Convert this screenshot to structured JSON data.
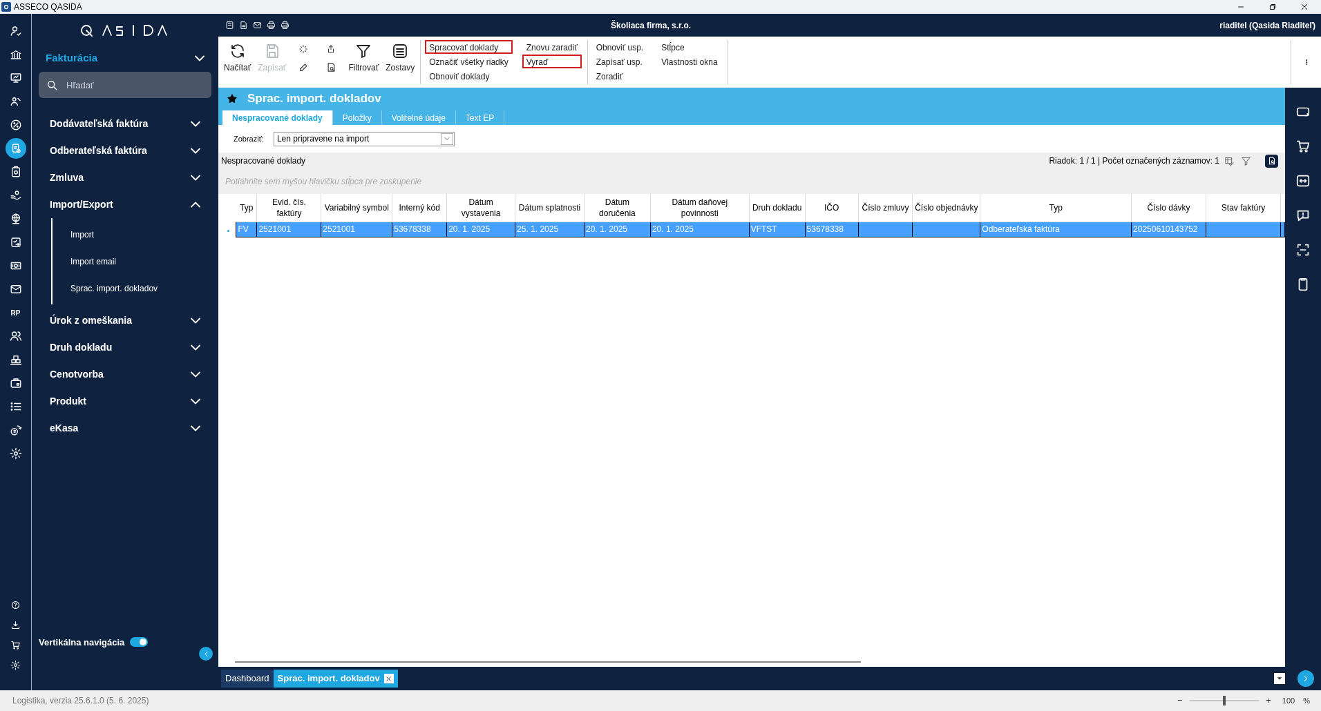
{
  "app_title": "ASSECO QASIDA",
  "header": {
    "company": "Školiaca firma, s.r.o.",
    "user": "riaditel (Qasida Riaditeľ)"
  },
  "rail": [
    {
      "kind": "icon",
      "selected": false
    },
    {
      "kind": "icon",
      "selected": false
    },
    {
      "kind": "icon",
      "selected": false
    },
    {
      "kind": "icon",
      "selected": false
    },
    {
      "kind": "icon",
      "selected": false
    },
    {
      "kind": "icon",
      "selected": true
    },
    {
      "kind": "icon",
      "selected": false
    },
    {
      "kind": "icon",
      "selected": false
    },
    {
      "kind": "icon",
      "selected": false
    },
    {
      "kind": "icon",
      "selected": false
    },
    {
      "kind": "icon",
      "selected": false
    },
    {
      "kind": "icon",
      "selected": false
    },
    {
      "kind": "text",
      "label": "RP",
      "selected": false
    },
    {
      "kind": "icon",
      "selected": false
    },
    {
      "kind": "icon",
      "selected": false
    },
    {
      "kind": "icon",
      "selected": false
    },
    {
      "kind": "icon",
      "selected": false
    },
    {
      "kind": "icon",
      "selected": false
    },
    {
      "kind": "icon",
      "selected": false
    }
  ],
  "sidebar": {
    "module": "Fakturácia",
    "search": {
      "placeholder": "Hľadať"
    },
    "items": [
      {
        "label": "Dodávateľská faktúra",
        "expanded": false
      },
      {
        "label": "Odberateľská faktúra",
        "expanded": false
      },
      {
        "label": "Zmluva",
        "expanded": false
      },
      {
        "label": "Import/Export",
        "expanded": true,
        "children": [
          {
            "label": "Import"
          },
          {
            "label": "Import email"
          },
          {
            "label": "Sprac. import. dokladov"
          }
        ]
      },
      {
        "label": "Úrok z omeškania",
        "expanded": false
      },
      {
        "label": "Druh dokladu",
        "expanded": false
      },
      {
        "label": "Cenotvorba",
        "expanded": false
      },
      {
        "label": "Produkt",
        "expanded": false
      },
      {
        "label": "eKasa",
        "expanded": false
      }
    ],
    "vertical_nav": {
      "label": "Vertikálna navigácia",
      "on": true
    }
  },
  "toolbar": {
    "buttons": [
      {
        "kind": "refresh",
        "label": "Načítať",
        "disabled": false
      },
      {
        "kind": "save",
        "label": "Zapísať",
        "disabled": true
      },
      {
        "kind": "stack"
      },
      {
        "kind": "stack2"
      },
      {
        "kind": "filter",
        "label": "Filtrovať",
        "disabled": false
      },
      {
        "kind": "reports",
        "label": "Zostavy",
        "disabled": false
      }
    ],
    "action_groups": [
      [
        {
          "label": "Spracovať doklady",
          "highlighted": true
        },
        {
          "label": "Označiť všetky riadky",
          "highlighted": false
        },
        {
          "label": "Obnoviť doklady",
          "highlighted": false
        }
      ],
      [
        {
          "label": "Znovu zaradiť",
          "highlighted": false
        },
        {
          "label": "Vyraď",
          "highlighted": true
        }
      ],
      [
        {
          "label": "Obnoviť usp.",
          "highlighted": false
        },
        {
          "label": "Zapísať usp.",
          "highlighted": false
        },
        {
          "label": "Zoradiť",
          "highlighted": false
        }
      ],
      [
        {
          "label": "Stĺpce",
          "highlighted": false
        },
        {
          "label": "Vlastnosti okna",
          "highlighted": false
        }
      ]
    ]
  },
  "page_title": "Sprac. import. dokladov",
  "tabs": [
    {
      "label": "Nespracované doklady",
      "selected": true
    },
    {
      "label": "Položky",
      "selected": false
    },
    {
      "label": "Volitelné údaje",
      "selected": false
    },
    {
      "label": "Text EP",
      "selected": false
    }
  ],
  "filter": {
    "label": "Zobraziť:",
    "value": "Len pripravene na import"
  },
  "grid": {
    "caption": "Nespracované doklady",
    "status": "Riadok: 1 / 1 | Počet označených záznamov: 1",
    "group_hint": "Potiahnite sem myšou hlavičku stĺpca pre zoskupenie",
    "columns": [
      "Typ",
      "Evid. čís. faktúry",
      "Variabilný symbol",
      "Interný kód",
      "Dátum vystavenia",
      "Dátum splatnosti",
      "Dátum doručenia",
      "Dátum daňovej povinnosti",
      "Druh dokladu",
      "IČO",
      "Číslo zmluvy",
      "Číslo objednávky",
      "Typ",
      "Číslo dávky",
      "Stav faktúry"
    ],
    "rows": [
      {
        "selected": true,
        "cells": [
          "FV",
          "2521001",
          "2521001",
          "53678338",
          "20. 1. 2025",
          "25. 1. 2025",
          "20. 1. 2025",
          "20. 1. 2025",
          "VFTST",
          "53678338",
          "",
          "",
          "Odberateľská faktúra",
          "20250610143752",
          ""
        ]
      }
    ]
  },
  "bottom_tabs": [
    {
      "label": "Dashboard",
      "selected": false
    },
    {
      "label": "Sprac. import. dokladov",
      "selected": true,
      "closable": true
    }
  ],
  "status_bar": {
    "version": "Logistika, verzia 25.6.1.0 (5. 6. 2025)",
    "zoom": {
      "minus": "−",
      "plus": "+",
      "level": 0.5,
      "value": "100",
      "unit": "%"
    }
  }
}
